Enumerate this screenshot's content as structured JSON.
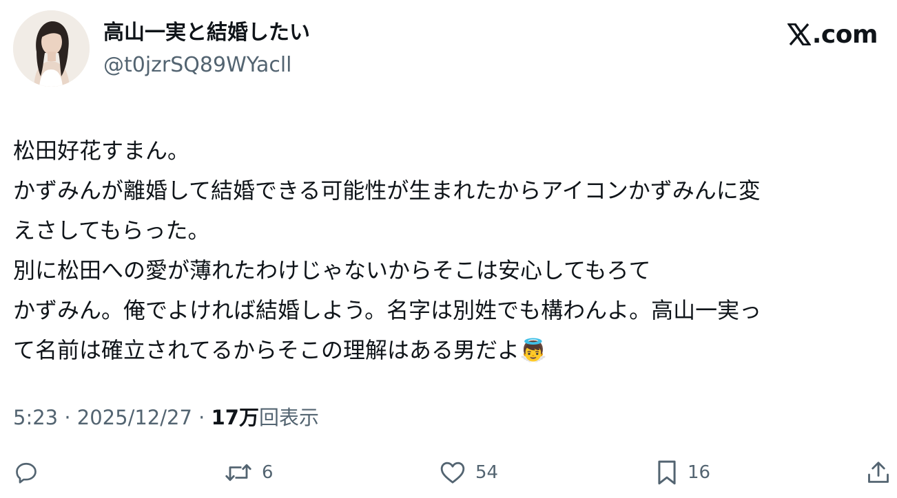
{
  "author": {
    "display_name": "高山一実と結婚したい",
    "handle": "@t0jzrSQ89WYacll",
    "avatar_icon": "profile-photo"
  },
  "brand": {
    "text": ".com",
    "logo_icon": "x-logo-icon"
  },
  "tweet": {
    "lines": [
      "松田好花すまん。",
      "かずみんが離婚して結婚できる可能性が生まれたからアイコンかずみんに変",
      "えさしてもらった。",
      "別に松田への愛が薄れたわけじゃないからそこは安心してもろて",
      "かずみん。俺でよければ結婚しよう。名字は別姓でも構わんよ。高山一実っ",
      "て名前は確立されてるからそこの理解はある男だよ👼"
    ]
  },
  "meta": {
    "time": "5:23",
    "separator": " · ",
    "date": "2025/12/27",
    "views_count": "17万",
    "views_label": "回表示"
  },
  "actions": {
    "reply": {
      "icon": "reply-icon"
    },
    "retweet": {
      "icon": "retweet-icon",
      "count": "6"
    },
    "like": {
      "icon": "heart-icon",
      "count": "54"
    },
    "bookmark": {
      "icon": "bookmark-icon",
      "count": "16"
    },
    "share": {
      "icon": "share-icon"
    }
  },
  "colors": {
    "text_primary": "#0f1419",
    "text_secondary": "#536471",
    "background": "#ffffff"
  }
}
